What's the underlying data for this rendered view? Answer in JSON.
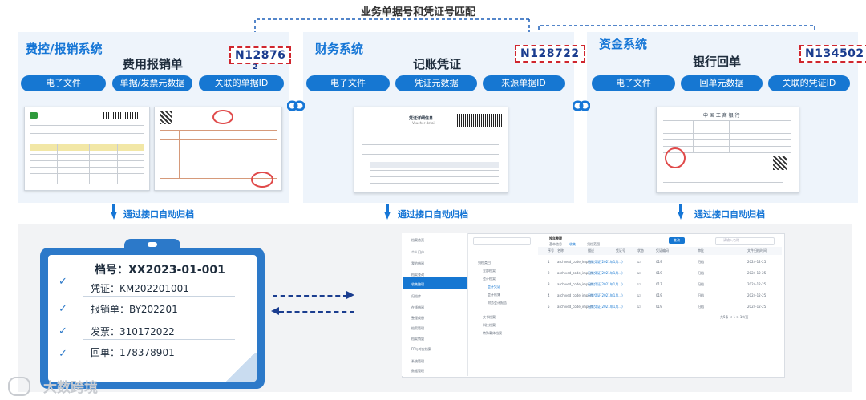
{
  "top_label": "业务单据号和凭证号匹配",
  "systems": [
    {
      "name": "费控/报销系统",
      "doc_title": "费用报销单",
      "doc_id": "N12876",
      "doc_id_suffix": "2",
      "pills": [
        "电子文件",
        "单据/发票元数据",
        "关联的单据ID"
      ]
    },
    {
      "name": "财务系统",
      "doc_title": "记账凭证",
      "doc_id": "N128722",
      "pills": [
        "电子文件",
        "凭证元数据",
        "来源单据ID"
      ]
    },
    {
      "name": "资金系统",
      "doc_title": "银行回单",
      "doc_id": "N134502",
      "pills": [
        "电子文件",
        "回单元数据",
        "关联的凭证ID"
      ]
    }
  ],
  "archive_label": "通过接口自动归档",
  "archive": {
    "number_label": "档号：XX2023-01-001",
    "rows": [
      {
        "label": "凭证：KM202201001"
      },
      {
        "label": "报销单：BY202201"
      },
      {
        "label": "发票：310172022"
      },
      {
        "label": "回单：178378901"
      }
    ]
  },
  "voucher_doc": {
    "title": "凭证详细信息",
    "subtitle": "Voucher detail"
  },
  "bank_doc": {
    "title": "中 国 工 商 银 行"
  },
  "screenshot": {
    "sidebar": [
      "档案首页",
      "个人门户",
      "我的借阅",
      "档案查询",
      "收集整理",
      "归档库",
      "在线借阅",
      "整理成册",
      "档案管理",
      "档案销毁",
      "FP与对应档案",
      "系统管理",
      "数据管理"
    ],
    "tree": [
      "归档类目",
      "全部档案",
      "会计档案",
      "会计凭证",
      "会计账簿",
      "财务会计报告",
      "文书档案",
      "科技档案",
      "特殊载体档案"
    ],
    "header_title": "按年整理",
    "tabs": [
      "基本信息",
      "收集",
      "归档范围",
      "档案详情"
    ],
    "button": "查询",
    "search_placeholder": "请输入名称",
    "columns": [
      "序号",
      "名称",
      "描述",
      "凭证号",
      "状态",
      "凭证编码",
      "审批",
      "文件归档时间"
    ],
    "rows": [
      [
        "1",
        "archived_code_import",
        "记账凭证(2021年1月...)",
        "☑",
        "019",
        "归档",
        "2024-12-25"
      ],
      [
        "2",
        "archived_code_import",
        "记账凭证(2021年1月...)",
        "☑",
        "019",
        "归档",
        "2024-12-25"
      ],
      [
        "3",
        "archived_code_import",
        "记账凭证(2021年1月...)",
        "☑",
        "017",
        "归档",
        "2024-12-25"
      ],
      [
        "4",
        "archived_code_import",
        "记账凭证(2021年1月...)",
        "☑",
        "019",
        "归档",
        "2024-12-25"
      ],
      [
        "5",
        "archived_code_import",
        "记账凭证(2021年1月...)",
        "☑",
        "019",
        "归档",
        "2024-12-25"
      ]
    ],
    "pagination": "共5条 < 1 > 10/页"
  },
  "watermark": "大数跨境",
  "colors": {
    "accent": "#1676d6",
    "id_border": "#d0262e",
    "clipboard": "#2c79c9"
  }
}
